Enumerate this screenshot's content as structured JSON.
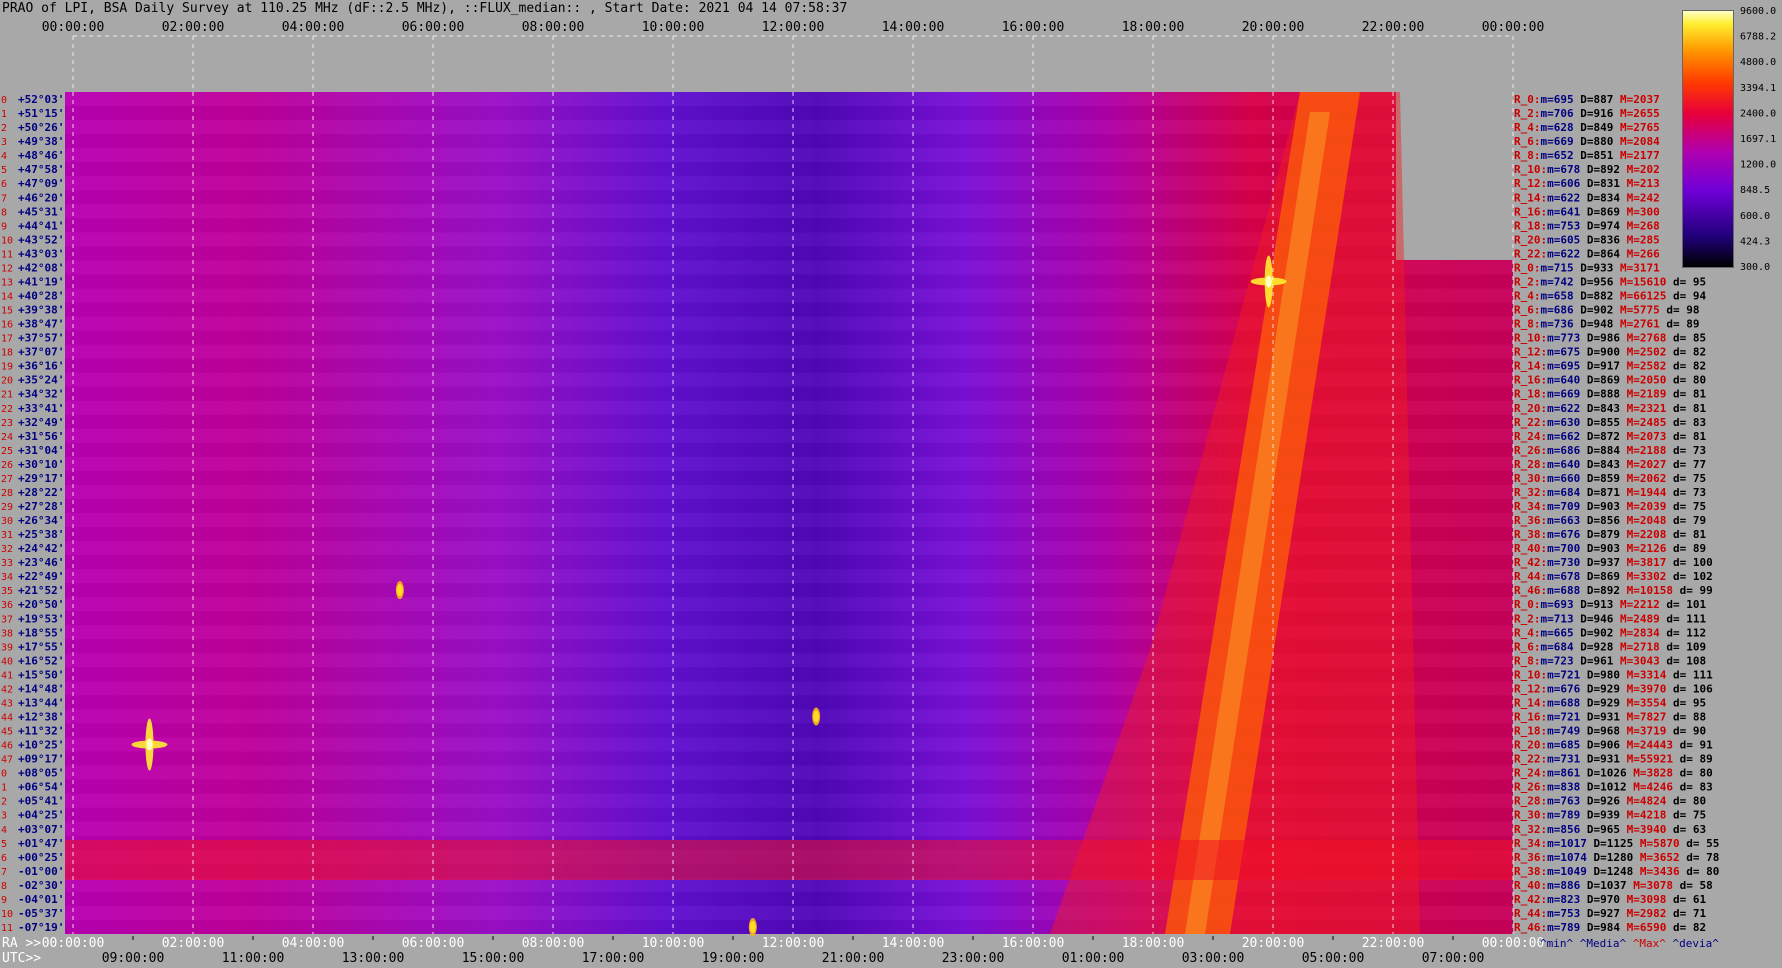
{
  "title": "PRAO of LPI, BSA Daily Survey at 110.25 MHz (dF::2.5 MHz), ::FLUX_median:: , Start Date: 2021 04 14 07:58:37",
  "colors": {
    "background": "#a8a8a8",
    "gridline": "#ffffff",
    "label_black": "#000000",
    "label_red": "#cc0000",
    "label_navy": "#000080"
  },
  "chart_data": {
    "type": "heatmap",
    "x_top_ticks": [
      "00:00:00",
      "02:00:00",
      "04:00:00",
      "06:00:00",
      "08:00:00",
      "10:00:00",
      "12:00:00",
      "14:00:00",
      "16:00:00",
      "18:00:00",
      "20:00:00",
      "22:00:00",
      "00:00:00"
    ],
    "x_bottom_ra_prefix": "RA >>",
    "x_bottom_ra_ticks": [
      "00:00:00",
      "02:00:00",
      "04:00:00",
      "06:00:00",
      "08:00:00",
      "10:00:00",
      "12:00:00",
      "14:00:00",
      "16:00:00",
      "18:00:00",
      "20:00:00",
      "22:00:00",
      "00:00:00"
    ],
    "x_bottom_utc_prefix": "UTC>>",
    "x_bottom_utc_ticks": [
      "09:00:00",
      "11:00:00",
      "13:00:00",
      "15:00:00",
      "17:00:00",
      "19:00:00",
      "21:00:00",
      "23:00:00",
      "01:00:00",
      "03:00:00",
      "05:00:00",
      "07:00:00"
    ],
    "y_declinations": [
      "+52°03'",
      "+51°15'",
      "+50°26'",
      "+49°38'",
      "+48°46'",
      "+47°58'",
      "+47°09'",
      "+46°20'",
      "+45°31'",
      "+44°41'",
      "+43°52'",
      "+43°03'",
      "+42°08'",
      "+41°19'",
      "+40°28'",
      "+39°38'",
      "+38°47'",
      "+37°57'",
      "+37°07'",
      "+36°16'",
      "+35°24'",
      "+34°32'",
      "+33°41'",
      "+32°49'",
      "+31°56'",
      "+31°04'",
      "+30°10'",
      "+29°17'",
      "+28°22'",
      "+27°28'",
      "+26°34'",
      "+25°38'",
      "+24°42'",
      "+23°46'",
      "+22°49'",
      "+21°52'",
      "+20°50'",
      "+19°53'",
      "+18°55'",
      "+17°55'",
      "+16°52'",
      "+15°50'",
      "+14°48'",
      "+13°44'",
      "+12°38'",
      "+11°32'",
      "+10°25'",
      "+09°17'",
      "+08°05'",
      "+06°54'",
      "+05°41'",
      "+04°25'",
      "+03°07'",
      "+01°47'",
      "+00°25'",
      "-01°00'",
      "-02°30'",
      "-04°01'",
      "-05°37'",
      "-07°19'"
    ],
    "colorbar": {
      "min": 300.0,
      "max": 9600.0,
      "scale": "log",
      "tick_labels": [
        "9600.0",
        "6788.2",
        "4800.0",
        "3394.1",
        "2400.0",
        "1697.1",
        "1200.0",
        "848.5",
        "600.0",
        "424.3",
        "300.0"
      ]
    },
    "stats_headers": [
      "^min^",
      "^Media^",
      "^Max^",
      "^devia^"
    ],
    "stats": [
      {
        "r": "R_0:",
        "min": "695",
        "med": "887",
        "max": "2037",
        "dev": ""
      },
      {
        "r": "R_2:",
        "min": "706",
        "med": "916",
        "max": "2655",
        "dev": ""
      },
      {
        "r": "R_4:",
        "min": "628",
        "med": "849",
        "max": "2765",
        "dev": ""
      },
      {
        "r": "R_6:",
        "min": "669",
        "med": "880",
        "max": "2084",
        "dev": ""
      },
      {
        "r": "R_8:",
        "min": "652",
        "med": "851",
        "max": "2177",
        "dev": ""
      },
      {
        "r": "R_10:",
        "min": "678",
        "med": "892",
        "max": "202",
        "dev": ""
      },
      {
        "r": "R_12:",
        "min": "606",
        "med": "831",
        "max": "213",
        "dev": ""
      },
      {
        "r": "R_14:",
        "min": "622",
        "med": "834",
        "max": "242",
        "dev": ""
      },
      {
        "r": "R_16:",
        "min": "641",
        "med": "869",
        "max": "300",
        "dev": ""
      },
      {
        "r": "R_18:",
        "min": "753",
        "med": "974",
        "max": "268",
        "dev": ""
      },
      {
        "r": "R_20:",
        "min": "605",
        "med": "836",
        "max": "285",
        "dev": ""
      },
      {
        "r": "R_22:",
        "min": "622",
        "med": "864",
        "max": "266",
        "dev": ""
      },
      {
        "r": "R_0:",
        "min": "715",
        "med": "933",
        "max": "3171",
        "dev": ""
      },
      {
        "r": "R_2:",
        "min": "742",
        "med": "956",
        "max": "15610",
        "dev": "95"
      },
      {
        "r": "R_4:",
        "min": "658",
        "med": "882",
        "max": "66125",
        "dev": "94"
      },
      {
        "r": "R_6:",
        "min": "686",
        "med": "902",
        "max": "5775",
        "dev": "98"
      },
      {
        "r": "R_8:",
        "min": "736",
        "med": "948",
        "max": "2761",
        "dev": "89"
      },
      {
        "r": "R_10:",
        "min": "773",
        "med": "986",
        "max": "2768",
        "dev": "85"
      },
      {
        "r": "R_12:",
        "min": "675",
        "med": "900",
        "max": "2502",
        "dev": "82"
      },
      {
        "r": "R_14:",
        "min": "695",
        "med": "917",
        "max": "2582",
        "dev": "82"
      },
      {
        "r": "R_16:",
        "min": "640",
        "med": "869",
        "max": "2050",
        "dev": "80"
      },
      {
        "r": "R_18:",
        "min": "669",
        "med": "888",
        "max": "2189",
        "dev": "81"
      },
      {
        "r": "R_20:",
        "min": "622",
        "med": "843",
        "max": "2321",
        "dev": "81"
      },
      {
        "r": "R_22:",
        "min": "630",
        "med": "855",
        "max": "2485",
        "dev": "83"
      },
      {
        "r": "R_24:",
        "min": "662",
        "med": "872",
        "max": "2073",
        "dev": "81"
      },
      {
        "r": "R_26:",
        "min": "686",
        "med": "884",
        "max": "2188",
        "dev": "73"
      },
      {
        "r": "R_28:",
        "min": "640",
        "med": "843",
        "max": "2027",
        "dev": "77"
      },
      {
        "r": "R_30:",
        "min": "660",
        "med": "859",
        "max": "2062",
        "dev": "75"
      },
      {
        "r": "R_32:",
        "min": "684",
        "med": "871",
        "max": "1944",
        "dev": "73"
      },
      {
        "r": "R_34:",
        "min": "709",
        "med": "903",
        "max": "2039",
        "dev": "75"
      },
      {
        "r": "R_36:",
        "min": "663",
        "med": "856",
        "max": "2048",
        "dev": "79"
      },
      {
        "r": "R_38:",
        "min": "676",
        "med": "879",
        "max": "2208",
        "dev": "81"
      },
      {
        "r": "R_40:",
        "min": "700",
        "med": "903",
        "max": "2126",
        "dev": "89"
      },
      {
        "r": "R_42:",
        "min": "730",
        "med": "937",
        "max": "3817",
        "dev": "100"
      },
      {
        "r": "R_44:",
        "min": "678",
        "med": "869",
        "max": "3302",
        "dev": "102"
      },
      {
        "r": "R_46:",
        "min": "688",
        "med": "892",
        "max": "10158",
        "dev": "99"
      },
      {
        "r": "R_0:",
        "min": "693",
        "med": "913",
        "max": "2212",
        "dev": "101"
      },
      {
        "r": "R_2:",
        "min": "713",
        "med": "946",
        "max": "2489",
        "dev": "111"
      },
      {
        "r": "R_4:",
        "min": "665",
        "med": "902",
        "max": "2834",
        "dev": "112"
      },
      {
        "r": "R_6:",
        "min": "684",
        "med": "928",
        "max": "2718",
        "dev": "109"
      },
      {
        "r": "R_8:",
        "min": "723",
        "med": "961",
        "max": "3043",
        "dev": "108"
      },
      {
        "r": "R_10:",
        "min": "721",
        "med": "980",
        "max": "3314",
        "dev": "111"
      },
      {
        "r": "R_12:",
        "min": "676",
        "med": "929",
        "max": "3970",
        "dev": "106"
      },
      {
        "r": "R_14:",
        "min": "688",
        "med": "929",
        "max": "3554",
        "dev": "95"
      },
      {
        "r": "R_16:",
        "min": "721",
        "med": "931",
        "max": "7827",
        "dev": "88"
      },
      {
        "r": "R_18:",
        "min": "749",
        "med": "968",
        "max": "3719",
        "dev": "90"
      },
      {
        "r": "R_20:",
        "min": "685",
        "med": "906",
        "max": "24443",
        "dev": "91"
      },
      {
        "r": "R_22:",
        "min": "731",
        "med": "931",
        "max": "55921",
        "dev": "89"
      },
      {
        "r": "R_24:",
        "min": "861",
        "med": "1026",
        "max": "3828",
        "dev": "80"
      },
      {
        "r": "R_26:",
        "min": "838",
        "med": "1012",
        "max": "4246",
        "dev": "83"
      },
      {
        "r": "R_28:",
        "min": "763",
        "med": "926",
        "max": "4824",
        "dev": "80"
      },
      {
        "r": "R_30:",
        "min": "789",
        "med": "939",
        "max": "4218",
        "dev": "75"
      },
      {
        "r": "R_32:",
        "min": "856",
        "med": "965",
        "max": "3940",
        "dev": "63"
      },
      {
        "r": "R_34:",
        "min": "1017",
        "med": "1125",
        "max": "5870",
        "dev": "55"
      },
      {
        "r": "R_36:",
        "min": "1074",
        "med": "1280",
        "max": "3652",
        "dev": "78"
      },
      {
        "r": "R_38:",
        "min": "1049",
        "med": "1248",
        "max": "3436",
        "dev": "80"
      },
      {
        "r": "R_40:",
        "min": "886",
        "med": "1037",
        "max": "3078",
        "dev": "58"
      },
      {
        "r": "R_42:",
        "min": "823",
        "med": "970",
        "max": "3098",
        "dev": "61"
      },
      {
        "r": "R_44:",
        "min": "753",
        "med": "927",
        "max": "2982",
        "dev": "71"
      },
      {
        "r": "R_46:",
        "min": "789",
        "med": "984",
        "max": "6590",
        "dev": "82"
      }
    ],
    "bright_sources": [
      {
        "ra_hours": 1.4,
        "dec_label": "+10°25'",
        "intensity": "very high"
      },
      {
        "ra_hours": 19.95,
        "dec_label": "+41°19'",
        "intensity": "very high"
      },
      {
        "ra_hours": 5.55,
        "dec_label": "+21°52'",
        "intensity": "high"
      },
      {
        "ra_hours": 12.45,
        "dec_label": "+12°38'",
        "intensity": "high"
      },
      {
        "ra_hours": 11.4,
        "dec_label": "-07°19'",
        "intensity": "high"
      }
    ],
    "grid": true
  }
}
